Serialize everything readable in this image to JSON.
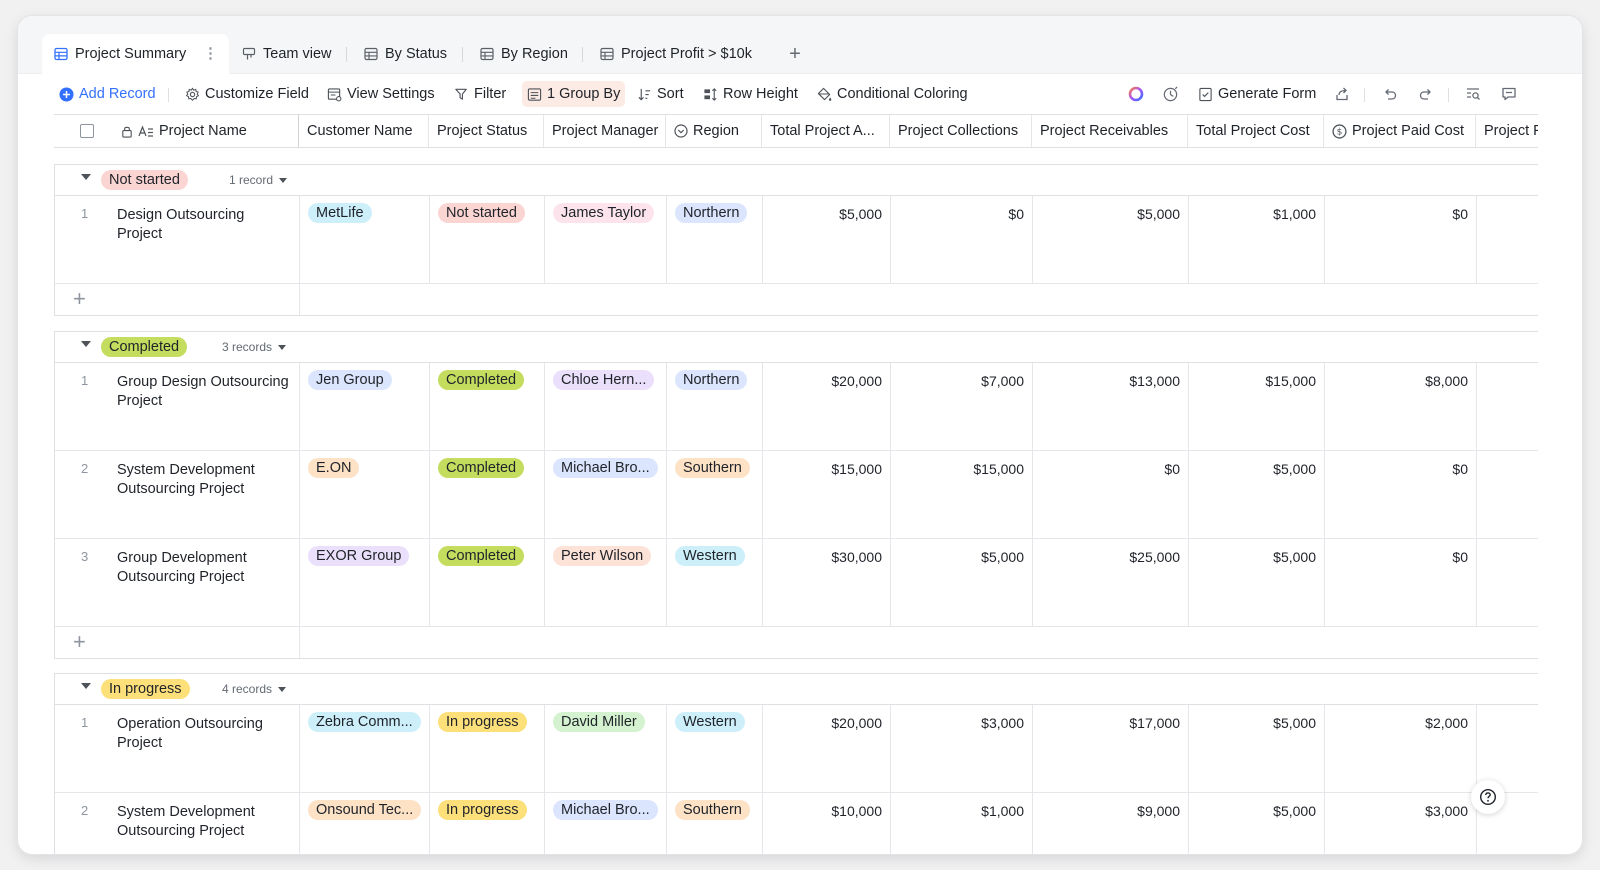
{
  "tabs": [
    {
      "label": "Project Summary",
      "icon": "grid-icon",
      "active": true
    },
    {
      "label": "Team view",
      "icon": "kanban-icon"
    },
    {
      "label": "By Status",
      "icon": "grid-icon"
    },
    {
      "label": "By Region",
      "icon": "grid-icon"
    },
    {
      "label": "Project Profit > $10k",
      "icon": "grid-icon"
    }
  ],
  "toolbar": {
    "add_record": "Add Record",
    "customize_field": "Customize Field",
    "view_settings": "View Settings",
    "filter": "Filter",
    "group_by": "1 Group By",
    "sort": "Sort",
    "row_height": "Row Height",
    "conditional_coloring": "Conditional Coloring",
    "generate_form": "Generate Form"
  },
  "columns": {
    "project_name": "Project Name",
    "customer_name": "Customer Name",
    "project_status": "Project Status",
    "project_manager": "Project Manager",
    "region": "Region",
    "total_project_amount": "Total Project A...",
    "project_collections": "Project Collections",
    "project_receivables": "Project Receivables",
    "total_project_cost": "Total Project Cost",
    "project_paid_cost": "Project Paid Cost",
    "project_p": "Project F"
  },
  "groups": [
    {
      "label": "Not started",
      "count": "1 record",
      "rows": [
        {
          "n": "1",
          "name": "Design Outsourcing Project",
          "customer": "MetLife",
          "status": "Not started",
          "manager": "James Taylor",
          "region": "Northern",
          "amount": "$5,000",
          "collections": "$0",
          "receivables": "$5,000",
          "cost": "$1,000",
          "paid": "$0"
        }
      ]
    },
    {
      "label": "Completed",
      "count": "3 records",
      "rows": [
        {
          "n": "1",
          "name": "Group Design Outsourcing Project",
          "customer": "Jen Group",
          "status": "Completed",
          "manager": "Chloe Hern...",
          "region": "Northern",
          "amount": "$20,000",
          "collections": "$7,000",
          "receivables": "$13,000",
          "cost": "$15,000",
          "paid": "$8,000"
        },
        {
          "n": "2",
          "name": "System Development Outsourcing Project",
          "customer": "E.ON",
          "status": "Completed",
          "manager": "Michael Bro...",
          "region": "Southern",
          "amount": "$15,000",
          "collections": "$15,000",
          "receivables": "$0",
          "cost": "$5,000",
          "paid": "$0"
        },
        {
          "n": "3",
          "name": "Group Development Outsourcing Project",
          "customer": "EXOR Group",
          "status": "Completed",
          "manager": "Peter Wilson",
          "region": "Western",
          "amount": "$30,000",
          "collections": "$5,000",
          "receivables": "$25,000",
          "cost": "$5,000",
          "paid": "$0"
        }
      ]
    },
    {
      "label": "In progress",
      "count": "4 records",
      "rows": [
        {
          "n": "1",
          "name": "Operation Outsourcing Project",
          "customer": "Zebra Comm...",
          "status": "In progress",
          "manager": "David Miller",
          "region": "Western",
          "amount": "$20,000",
          "collections": "$3,000",
          "receivables": "$17,000",
          "cost": "$5,000",
          "paid": "$2,000"
        },
        {
          "n": "2",
          "name": "System Development Outsourcing Project",
          "customer": "Onsound Tec...",
          "status": "In progress",
          "manager": "Michael Bro...",
          "region": "Southern",
          "amount": "$10,000",
          "collections": "$1,000",
          "receivables": "$9,000",
          "cost": "$5,000",
          "paid": "$3,000"
        }
      ]
    }
  ],
  "colors": {
    "accent": "#3370ff",
    "status_not_started": "#fbd5d2",
    "status_completed": "#c4dd5e",
    "status_in_progress": "#fde07a",
    "region_northern": "#dbe5fd",
    "region_southern": "#fde2c6",
    "region_western": "#cdeffa"
  }
}
